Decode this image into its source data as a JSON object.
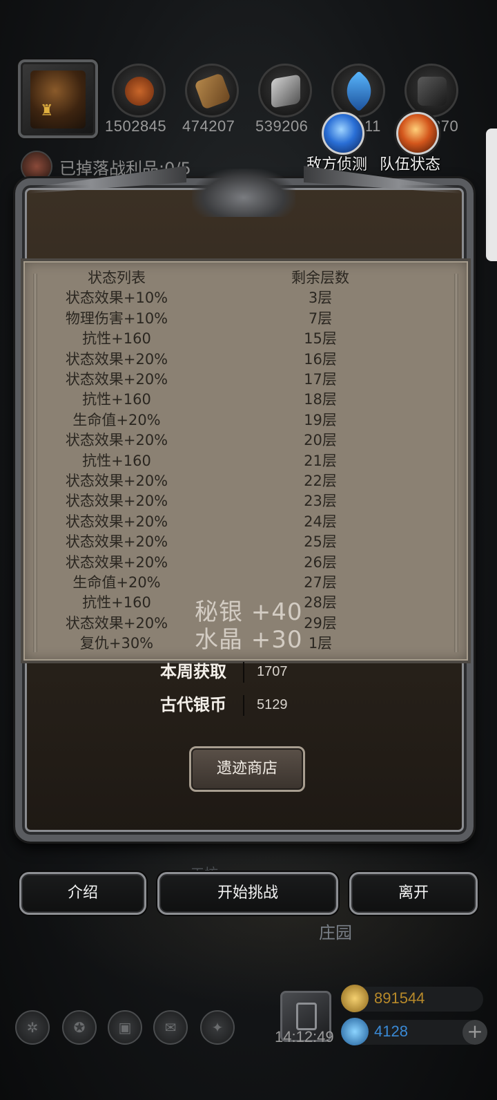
{
  "resources": [
    {
      "icon": "copper-ore-icon",
      "value": "1502845"
    },
    {
      "icon": "wood-plank-icon",
      "value": "474207"
    },
    {
      "icon": "iron-ingot-icon",
      "value": "539206"
    },
    {
      "icon": "blue-crystal-icon",
      "value": "11"
    },
    {
      "icon": "dark-stone-icon",
      "value": "370"
    }
  ],
  "quick_actions": {
    "enemy_scout": "敌方侦测",
    "team_status": "队伍状态"
  },
  "drop_status": "已掉落战利品:0/5",
  "status_list": {
    "header": {
      "name": "状态列表",
      "layers": "剩余层数"
    },
    "rows": [
      {
        "name": "状态效果+10%",
        "layers": "3层"
      },
      {
        "name": "物理伤害+10%",
        "layers": "7层"
      },
      {
        "name": "抗性+160",
        "layers": "15层"
      },
      {
        "name": "状态效果+20%",
        "layers": "16层"
      },
      {
        "name": "状态效果+20%",
        "layers": "17层"
      },
      {
        "name": "抗性+160",
        "layers": "18层"
      },
      {
        "name": "生命值+20%",
        "layers": "19层"
      },
      {
        "name": "状态效果+20%",
        "layers": "20层"
      },
      {
        "name": "抗性+160",
        "layers": "21层"
      },
      {
        "name": "状态效果+20%",
        "layers": "22层"
      },
      {
        "name": "状态效果+20%",
        "layers": "23层"
      },
      {
        "name": "状态效果+20%",
        "layers": "24层"
      },
      {
        "name": "状态效果+20%",
        "layers": "25层"
      },
      {
        "name": "状态效果+20%",
        "layers": "26层"
      },
      {
        "name": "生命值+20%",
        "layers": "27层"
      },
      {
        "name": "抗性+160",
        "layers": "28层"
      },
      {
        "name": "状态效果+20%",
        "layers": "29层"
      },
      {
        "name": "复仇+30%",
        "layers": "1层"
      }
    ]
  },
  "rewards_overlay": {
    "mithril": "秘银 +40",
    "crystal": "水晶 +30"
  },
  "stats": {
    "weekly_label": "本周获取",
    "weekly_value": "1707",
    "coin_label": "古代银币",
    "coin_value": "5129"
  },
  "shop_button": "遗迹商店",
  "actions": {
    "intro": "介绍",
    "start": "开始挑战",
    "leave": "离开"
  },
  "background": {
    "mine_label": "工坊",
    "manor_label": "庄园"
  },
  "footer": {
    "time": "14:12:49",
    "gold": "891544",
    "gems": "4128",
    "add": "+"
  }
}
